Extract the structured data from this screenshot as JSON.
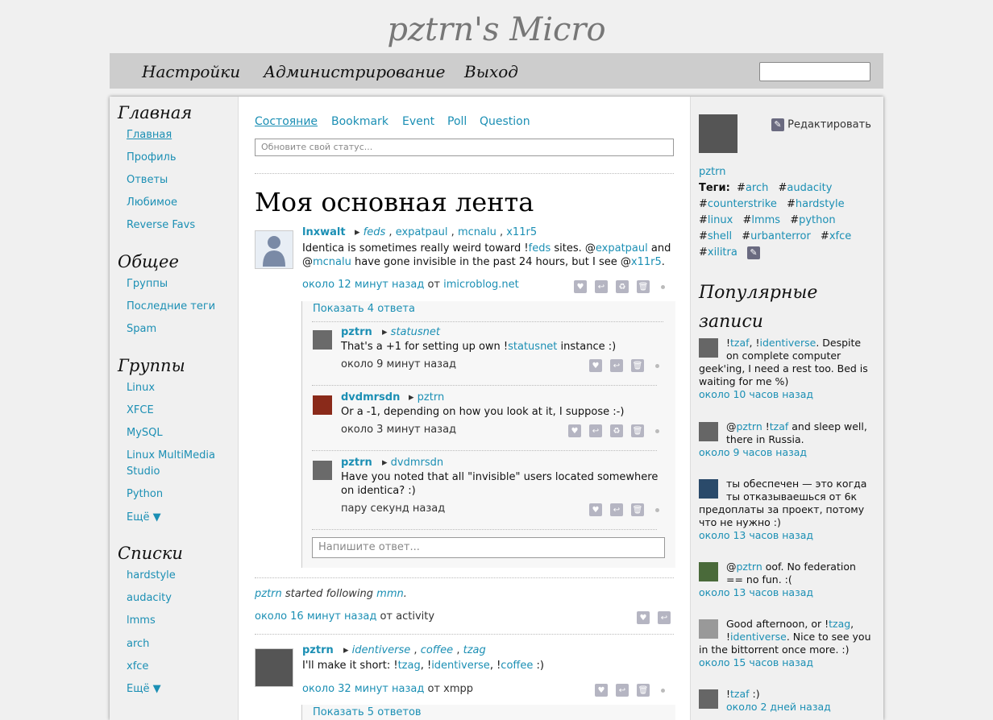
{
  "site": {
    "title": "pztrn's Micro"
  },
  "topnav": {
    "settings": "Настройки",
    "admin": "Администрирование",
    "logout": "Выход"
  },
  "left": {
    "home_heading": "Главная",
    "home_items": [
      "Главная",
      "Профиль",
      "Ответы",
      "Любимое",
      "Reverse Favs"
    ],
    "public_heading": "Общее",
    "public_items": [
      "Группы",
      "Последние теги",
      "Spam"
    ],
    "groups_heading": "Группы",
    "groups_items": [
      "Linux",
      "XFCE",
      "MySQL",
      "Linux MultiMedia Studio",
      "Python",
      "Ещё ▼"
    ],
    "lists_heading": "Списки",
    "lists_items": [
      "hardstyle",
      "audacity",
      "lmms",
      "arch",
      "xfce",
      "Ещё ▼"
    ]
  },
  "center": {
    "tabs": [
      "Состояние",
      "Bookmark",
      "Event",
      "Poll",
      "Question"
    ],
    "status_placeholder": "Обновите свой статус...",
    "feed_title": "Моя основная лента",
    "notice1": {
      "nick": "lnxwalt",
      "to": [
        "feds",
        "expatpaul",
        "mcnalu",
        "x11r5"
      ],
      "body_a": "Identica is sometimes really weird toward !",
      "body_b": "feds",
      "body_c": " sites. @",
      "body_d": "expatpaul",
      "body_e": " and @",
      "body_f": "mcnalu",
      "body_g": " have gone invisible in the past 24 hours, but I see @",
      "body_h": "x11r5",
      "body_i": ".",
      "time": "около 12 минут назад",
      "from_label": "от",
      "source": "imicroblog.net",
      "show_replies": "Показать 4 ответа"
    },
    "replies": [
      {
        "nick": "pztrn",
        "to": "statusnet",
        "body_a": "That's a +1 for setting up own !",
        "body_b": "statusnet",
        "body_c": " instance :)",
        "time": "около 9 минут назад"
      },
      {
        "nick": "dvdmrsdn",
        "to": "pztrn",
        "body": "Or a -1, depending on how you look at it, I suppose :-)",
        "time": "около 3 минут назад"
      },
      {
        "nick": "pztrn",
        "to": "dvdmrsdn",
        "body": "Have you noted that all \"invisible\" users located somewhere on identica? :)",
        "time": "пару секунд назад"
      }
    ],
    "reply_placeholder": "Напишите ответ...",
    "activity": {
      "actor": "pztrn",
      "verb": "started following",
      "target": "mmn",
      "time": "около 16 минут назад",
      "from_label": "от",
      "source": "activity"
    },
    "notice2": {
      "nick": "pztrn",
      "to": [
        "identiverse",
        "coffee",
        "tzag"
      ],
      "body_a": "I'll make it short: !",
      "body_b": "tzag",
      "body_c": ", !",
      "body_d": "identiverse",
      "body_e": ", !",
      "body_f": "coffee",
      "body_g": " :)",
      "time": "около 32 минут назад",
      "from_label": "от",
      "source": "xmpp",
      "show_replies": "Показать 5 ответов"
    }
  },
  "right": {
    "edit_label": "Редактировать",
    "user": "pztrn",
    "tags_label": "Теги:",
    "tags": [
      "arch",
      "audacity",
      "counterstrike",
      "hardstyle",
      "linux",
      "lmms",
      "python",
      "shell",
      "urbanterror",
      "xfce",
      "xilitra"
    ],
    "popular_title": "Популярные записи",
    "popular": [
      {
        "pre": "!",
        "l1": "tzaf",
        "mid": ", !",
        "l2": "identiverse",
        "post": ". Despite on complete computer geek'ing, I need a rest too. Bed is waiting for me %)",
        "time": "около 10 часов назад"
      },
      {
        "pre": "@",
        "l1": "pztrn",
        "mid": " !",
        "l2": "tzaf",
        "post": " and sleep well, there in Russia.",
        "time": "около 9 часов назад"
      },
      {
        "pre": "",
        "l1": "",
        "mid": "",
        "l2": "",
        "post": "ты обеспечен — это когда ты отказываешься от 6к предоплаты за проект, потому что не нужно :)",
        "time": "около 13 часов назад"
      },
      {
        "pre": "@",
        "l1": "pztrn",
        "mid": "",
        "l2": "",
        "post": " oof. No federation == no fun. :(",
        "time": "около 13 часов назад"
      },
      {
        "pre": "Good afternoon, or !",
        "l1": "tzag",
        "mid": ", !",
        "l2": "identiverse",
        "post": ". Nice to see you in the bittorrent once more. :)",
        "time": "около 15 часов назад"
      },
      {
        "pre": "!",
        "l1": "tzaf",
        "mid": "",
        "l2": "",
        "post": " :)",
        "time": "около 2 дней назад"
      }
    ]
  },
  "colors": {
    "link": "#1b8fb4",
    "bar": "#cdcdcd",
    "bg": "#f0f0f0"
  }
}
